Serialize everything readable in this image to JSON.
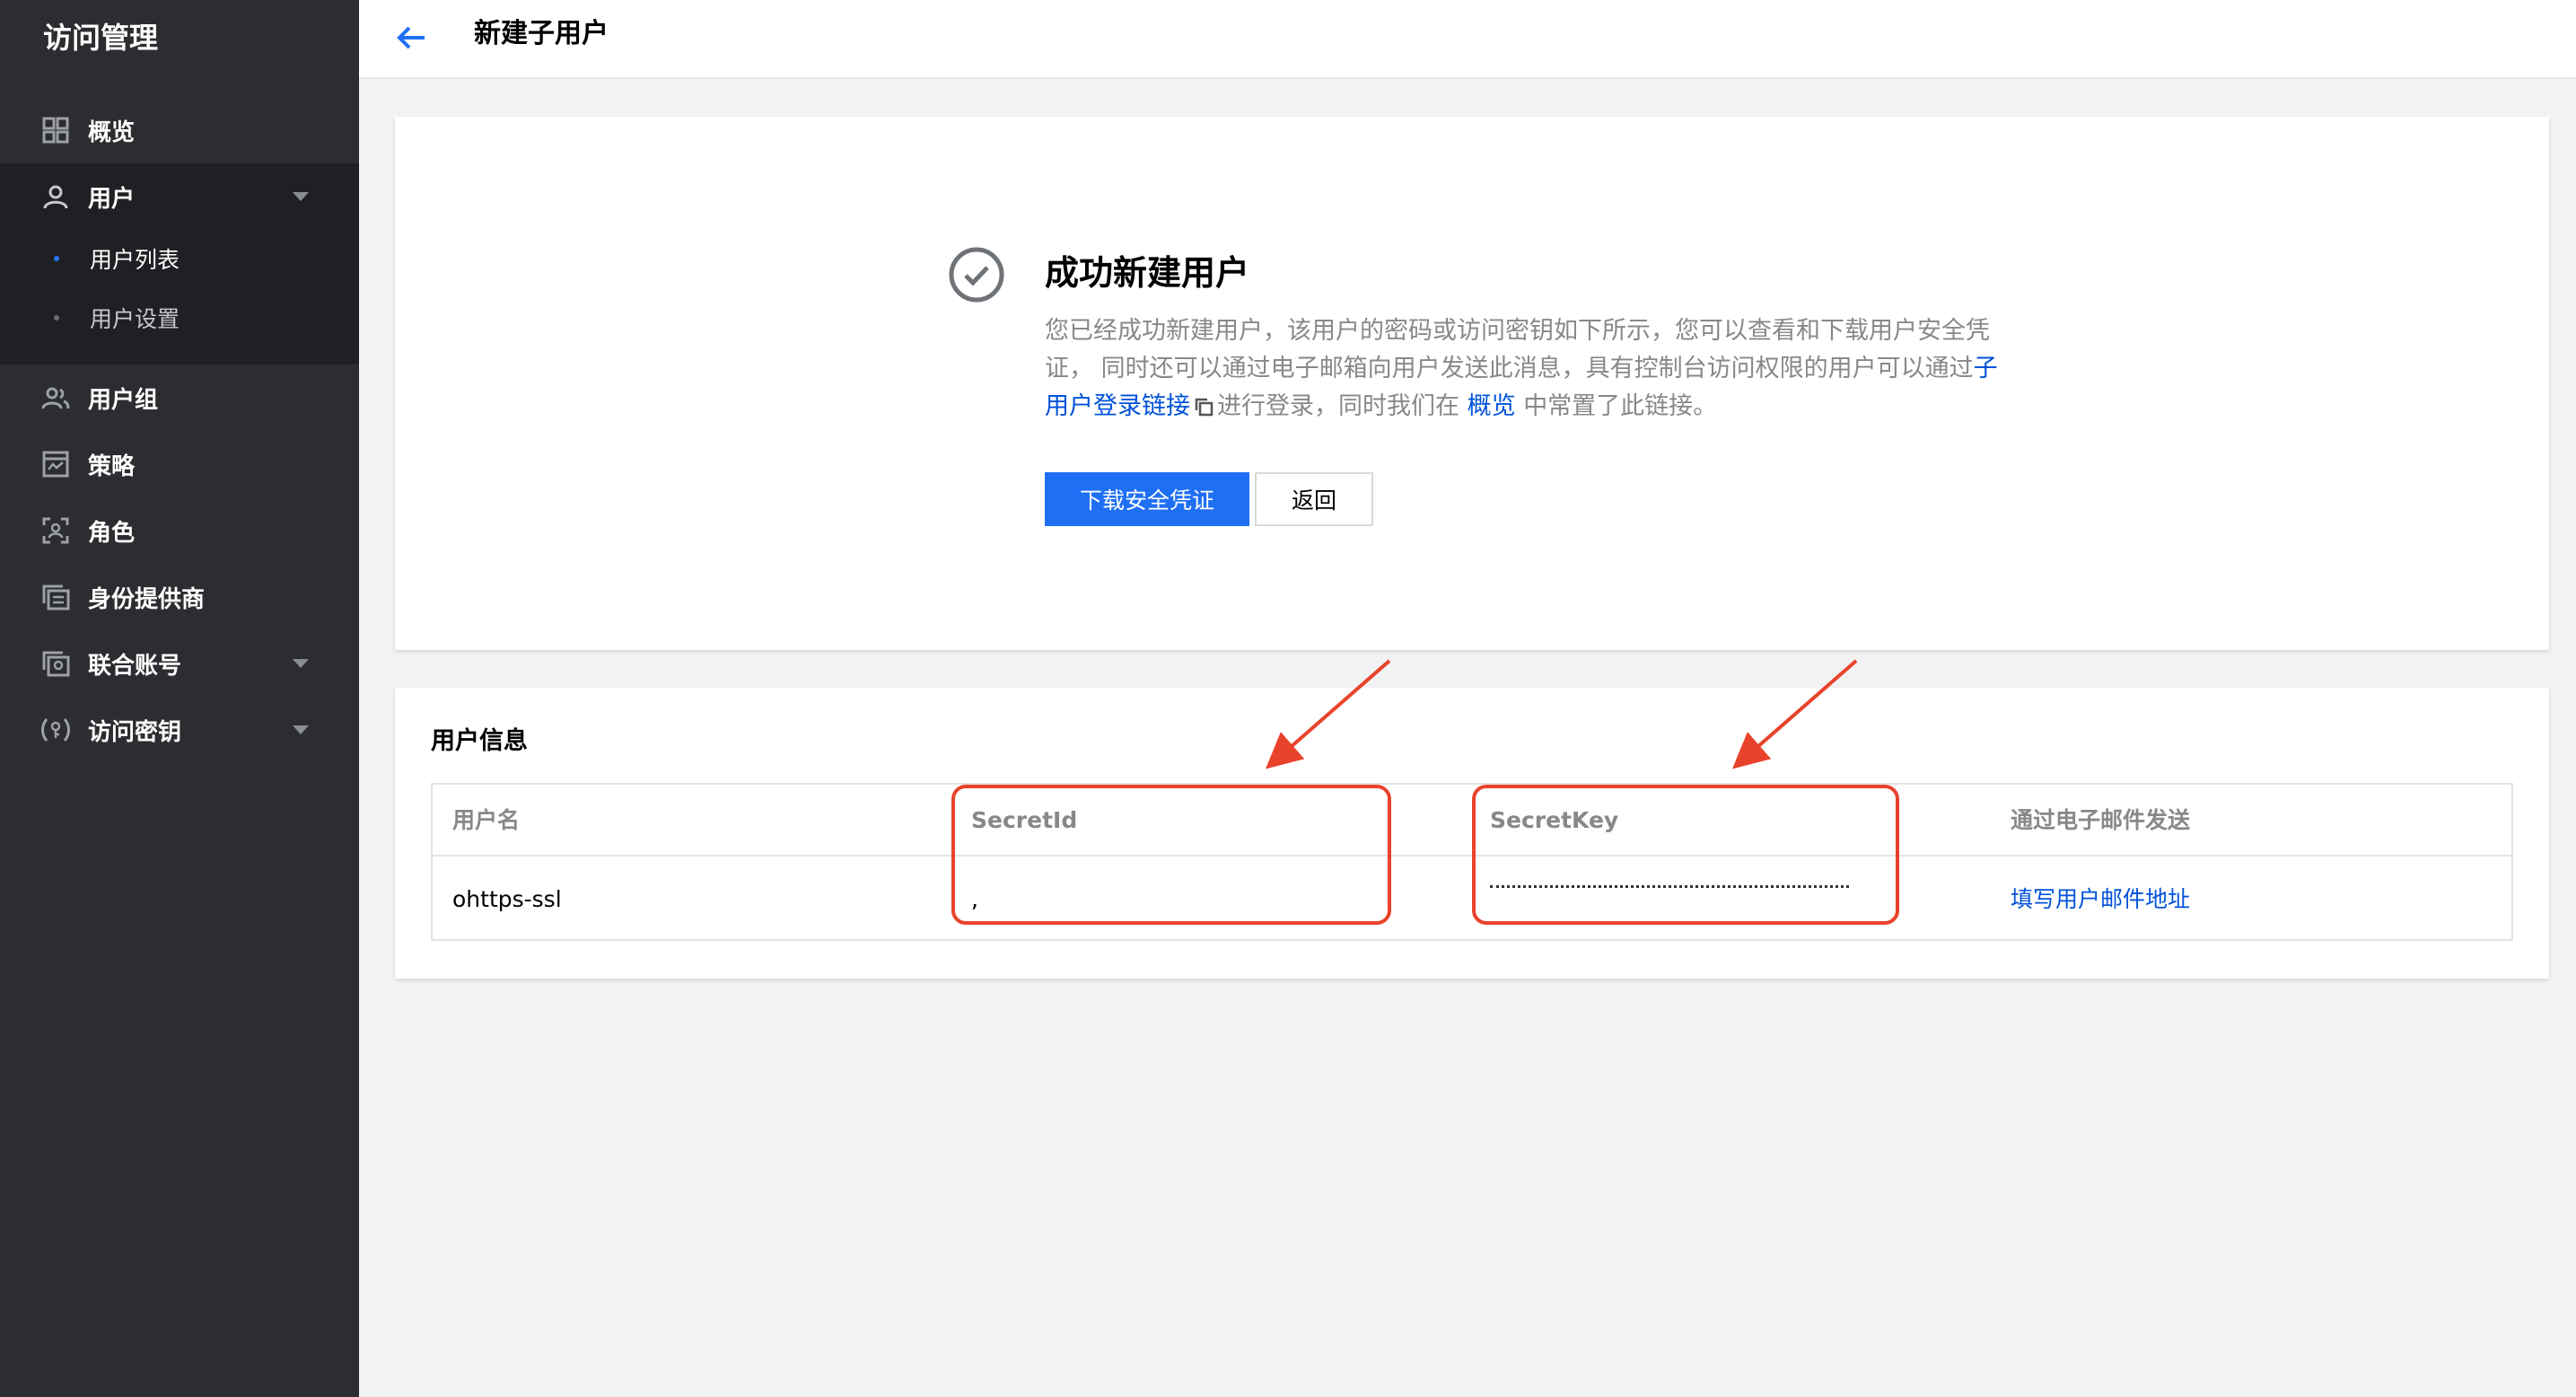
{
  "sidebar": {
    "title": "访问管理",
    "items": [
      {
        "label": "概览"
      },
      {
        "label": "用户"
      },
      {
        "label": "用户组"
      },
      {
        "label": "策略"
      },
      {
        "label": "角色"
      },
      {
        "label": "身份提供商"
      },
      {
        "label": "联合账号"
      },
      {
        "label": "访问密钥"
      }
    ],
    "subitems": [
      {
        "label": "用户列表",
        "active": true
      },
      {
        "label": "用户设置",
        "active": false
      }
    ]
  },
  "header": {
    "title": "新建子用户"
  },
  "success": {
    "title": "成功新建用户",
    "desc_part1": "您已经成功新建用户，该用户的密码或访问密钥如下所示，您可以查看和下载用户安全凭证， 同时还可以通过电子邮箱向用户发送此消息，具有控制台访问权限的用户可以通过",
    "desc_link1": "子用户登录链接",
    "desc_part2": "进行登录，同时我们在",
    "desc_link2": "概览",
    "desc_part3": "中常置了此链接。",
    "download_button": "下载安全凭证",
    "back_button": "返回"
  },
  "user_info": {
    "title": "用户信息",
    "columns": [
      "用户名",
      "SecretId",
      "SecretKey",
      "通过电子邮件发送"
    ],
    "row": {
      "username": "ohttps-ssl",
      "secret_id": ",",
      "secret_key": "",
      "email_link": "填写用户邮件地址"
    }
  },
  "colors": {
    "sidebar_bg": "#2b2d30",
    "primary": "#1f6ff5",
    "link": "#0052d9",
    "annotation": "#e9432c"
  }
}
